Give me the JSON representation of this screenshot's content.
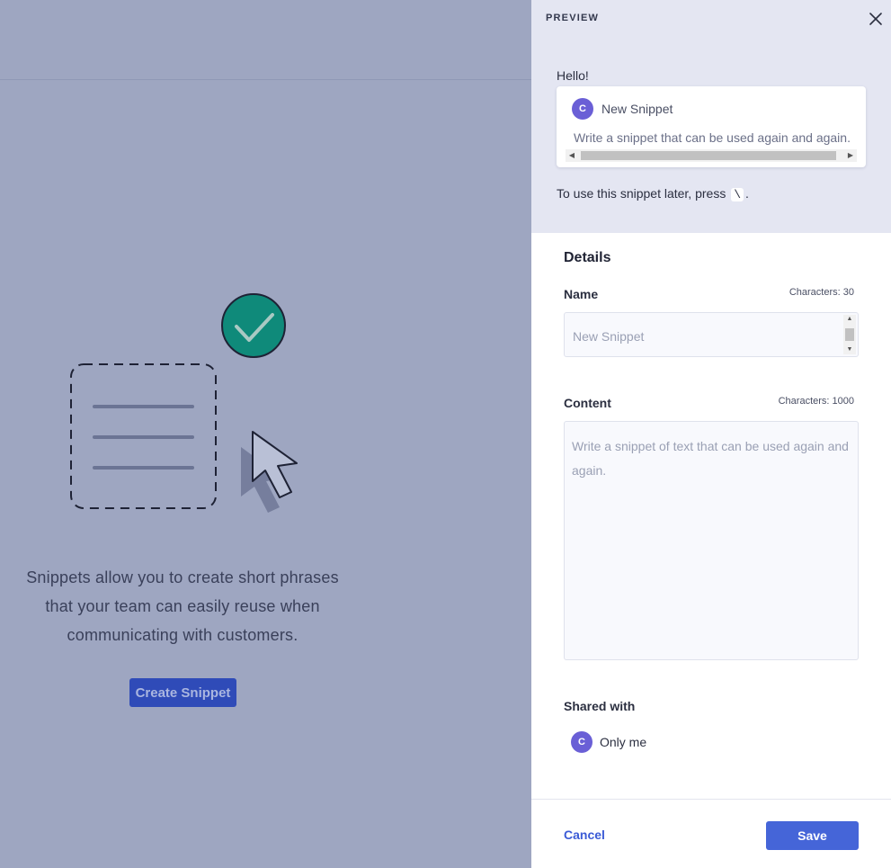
{
  "left": {
    "empty_text_line1": "Snippets allow you to create short phrases",
    "empty_text_line2": "that your team can easily reuse when",
    "empty_text_line3": "communicating with customers.",
    "create_button": "Create Snippet"
  },
  "preview": {
    "label": "PREVIEW",
    "greeting": "Hello!",
    "card": {
      "avatar_letter": "C",
      "title": "New Snippet",
      "content": "Write a snippet that can be used again and again."
    },
    "hint_before": "To use this snippet later, press",
    "hint_key": "\\",
    "hint_after": "."
  },
  "details": {
    "title": "Details",
    "name": {
      "label": "Name",
      "char_count": "Characters: 30",
      "placeholder": "New Snippet"
    },
    "content": {
      "label": "Content",
      "char_count": "Characters: 1000",
      "placeholder": "Write a snippet of text that can be used again and again."
    },
    "shared": {
      "label": "Shared with",
      "avatar_letter": "C",
      "value": "Only me"
    }
  },
  "footer": {
    "cancel": "Cancel",
    "save": "Save"
  },
  "colors": {
    "overlay": "#9ea6c1",
    "accent": "#4565d8",
    "avatar": "#6a5fd6",
    "check": "#0f8a7a"
  },
  "icons": [
    "close-icon",
    "check-circle-icon",
    "document-icon",
    "cursor-icon"
  ]
}
